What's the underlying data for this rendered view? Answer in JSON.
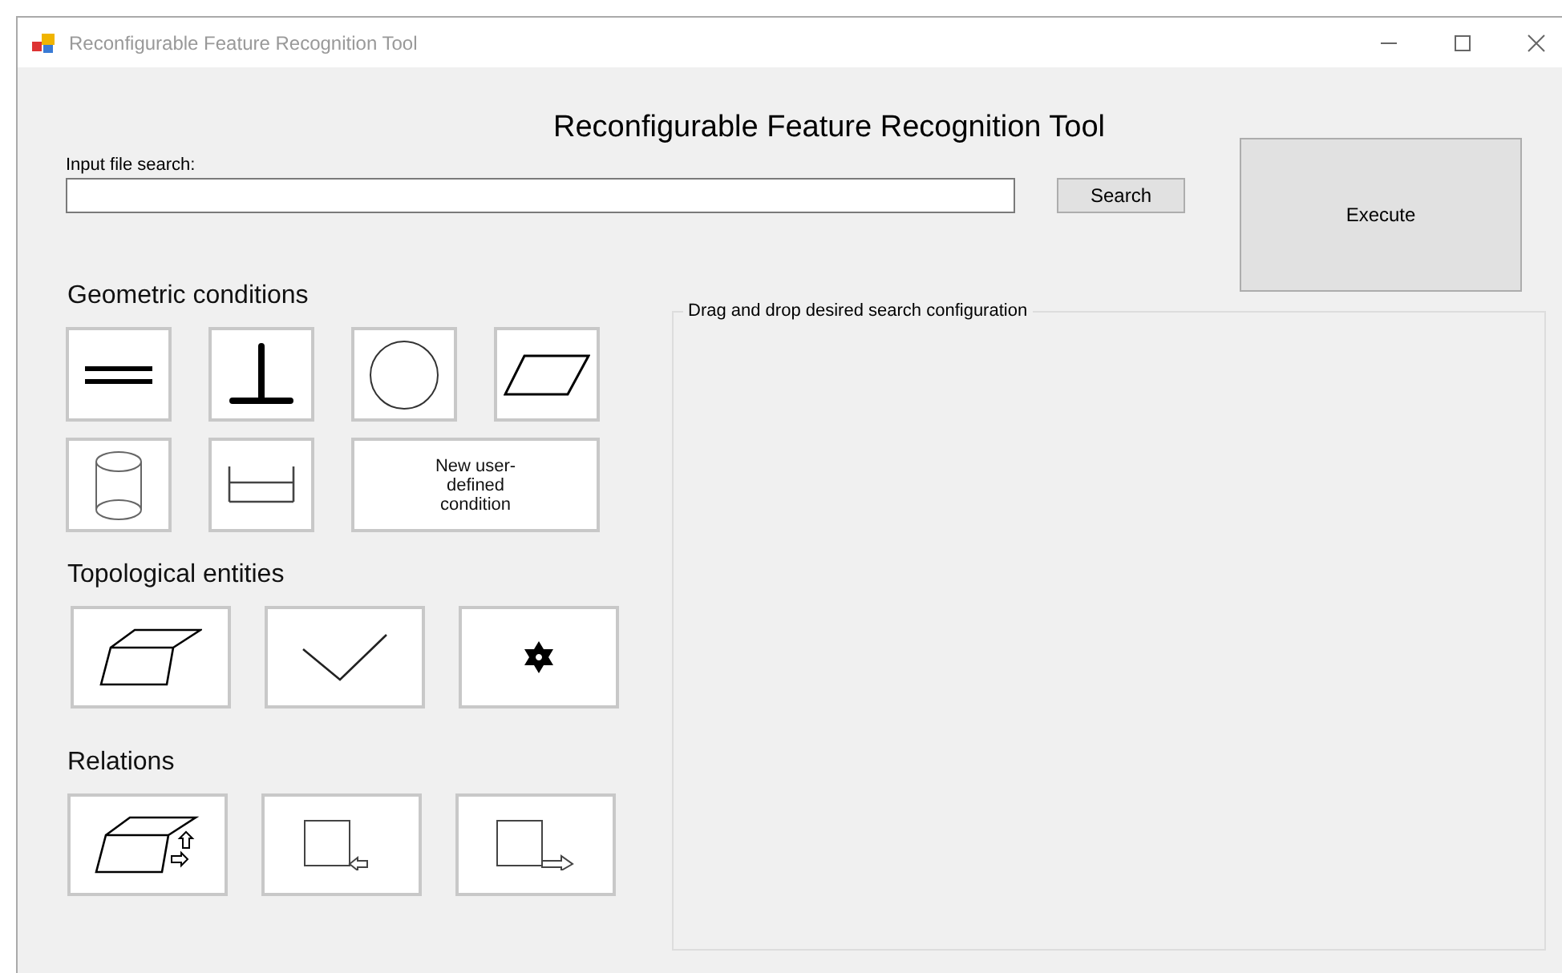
{
  "window": {
    "title": "Reconfigurable Feature Recognition Tool"
  },
  "heading": "Reconfigurable Feature Recognition Tool",
  "file_search": {
    "label": "Input file search:",
    "button": "Search"
  },
  "execute_button": "Execute",
  "sections": [
    {
      "title": "Geometric conditions",
      "tiles": [
        {
          "kind": "parallel"
        },
        {
          "kind": "perpendicular"
        },
        {
          "kind": "circle"
        },
        {
          "kind": "plane"
        },
        {
          "kind": "cylinder"
        },
        {
          "kind": "distance"
        },
        {
          "kind": "text",
          "label": "New user-defined condition"
        }
      ]
    },
    {
      "title": "Topological entities",
      "tiles": [
        {
          "kind": "face"
        },
        {
          "kind": "edge"
        },
        {
          "kind": "vertex"
        }
      ]
    },
    {
      "title": "Relations",
      "tiles": [
        {
          "kind": "face-adjacency"
        },
        {
          "kind": "inbound"
        },
        {
          "kind": "outbound"
        }
      ]
    }
  ],
  "drop_area": {
    "title": "Drag and drop desired search configuration"
  }
}
